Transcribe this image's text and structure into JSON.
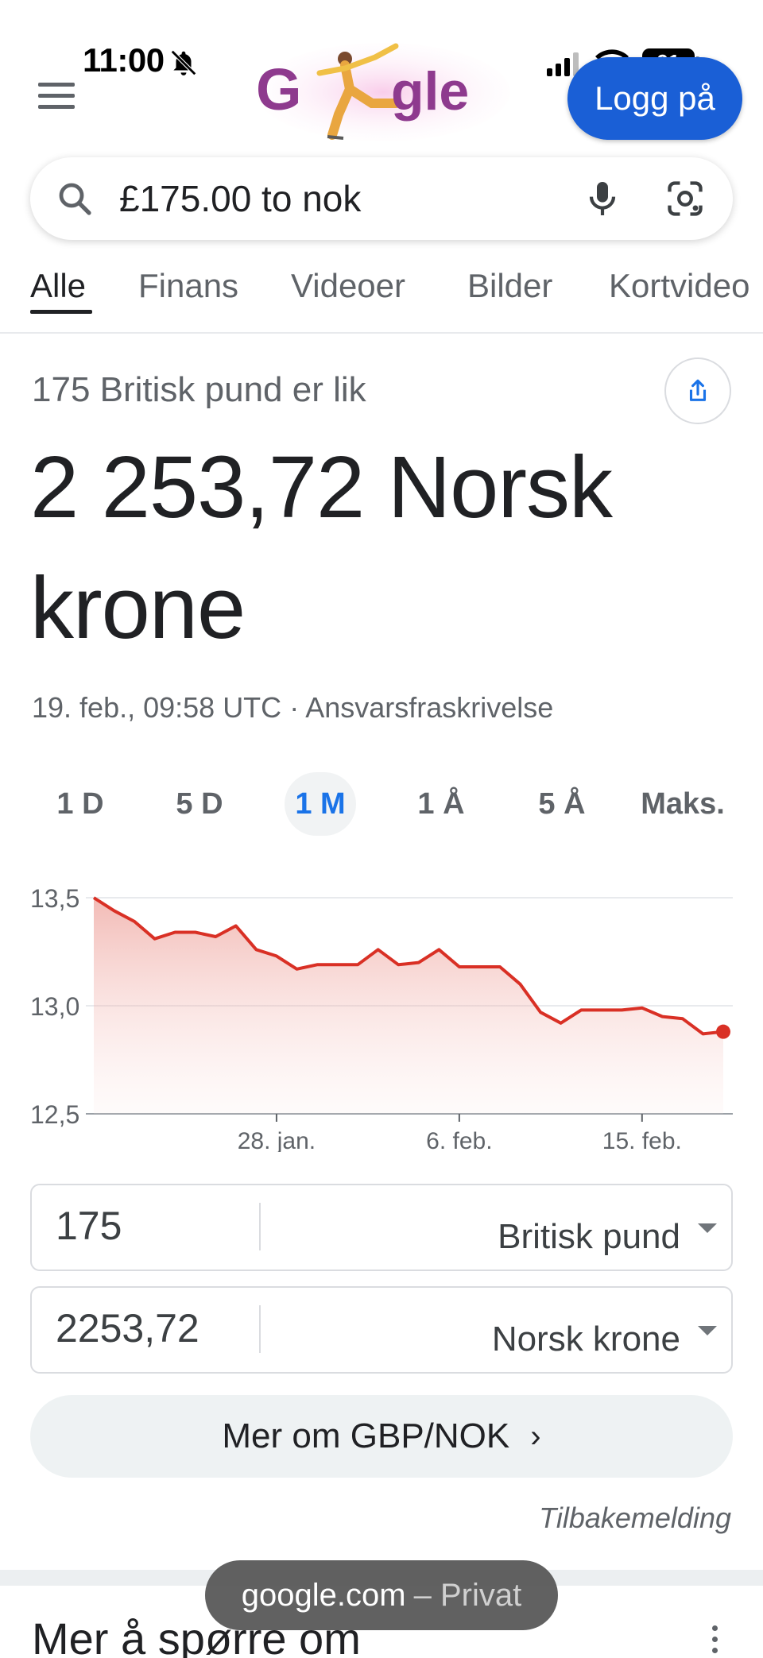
{
  "status_bar": {
    "time": "11:00",
    "battery": "91",
    "icons": [
      "bell-slash-icon",
      "signal-icon",
      "wifi-icon",
      "battery-icon"
    ]
  },
  "header": {
    "logo_text": "Google",
    "login_label": "Logg på"
  },
  "search": {
    "query": "£175.00 to nok"
  },
  "tabs": [
    {
      "label": "Alle",
      "active": true
    },
    {
      "label": "Finans"
    },
    {
      "label": "Videoer"
    },
    {
      "label": "Bilder"
    },
    {
      "label": "Kortvideo"
    }
  ],
  "result": {
    "intro": "175 Britisk pund er lik",
    "value": "2 253,72 Norsk krone",
    "timestamp": "19. feb., 09:58 UTC",
    "separator": " · ",
    "disclaimer": "Ansvarsfraskrivelse"
  },
  "ranges": [
    {
      "label": "1 D"
    },
    {
      "label": "5 D"
    },
    {
      "label": "1 M",
      "active": true
    },
    {
      "label": "1 Å"
    },
    {
      "label": "5 Å"
    },
    {
      "label": "Maks."
    }
  ],
  "chart_data": {
    "type": "area",
    "series_color": "#d93025",
    "y_tick_labels": [
      "13,5",
      "13,0",
      "12,5"
    ],
    "y_ticks": [
      13.5,
      13.0,
      12.5
    ],
    "ylim": [
      12.5,
      13.5
    ],
    "x_tick_labels": [
      "28. jan.",
      "6. feb.",
      "15. feb."
    ],
    "x_tick_index": [
      9,
      18,
      27
    ],
    "values": [
      13.5,
      13.44,
      13.39,
      13.31,
      13.34,
      13.34,
      13.32,
      13.37,
      13.26,
      13.23,
      13.17,
      13.19,
      13.19,
      13.19,
      13.26,
      13.19,
      13.2,
      13.26,
      13.18,
      13.18,
      13.18,
      13.1,
      12.97,
      12.92,
      12.98,
      12.98,
      12.98,
      12.99,
      12.95,
      12.94,
      12.87,
      12.88
    ],
    "grid": true
  },
  "converter": {
    "from_amount": "175",
    "from_currency": "Britisk pund",
    "to_amount": "2253,72",
    "to_currency": "Norsk krone"
  },
  "more_button": "Mer om GBP/NOK",
  "feedback": "Tilbakemelding",
  "browser_pill": {
    "domain": "google.com",
    "mode": "– Privat"
  },
  "next_section_title": "Mer å spørre om"
}
